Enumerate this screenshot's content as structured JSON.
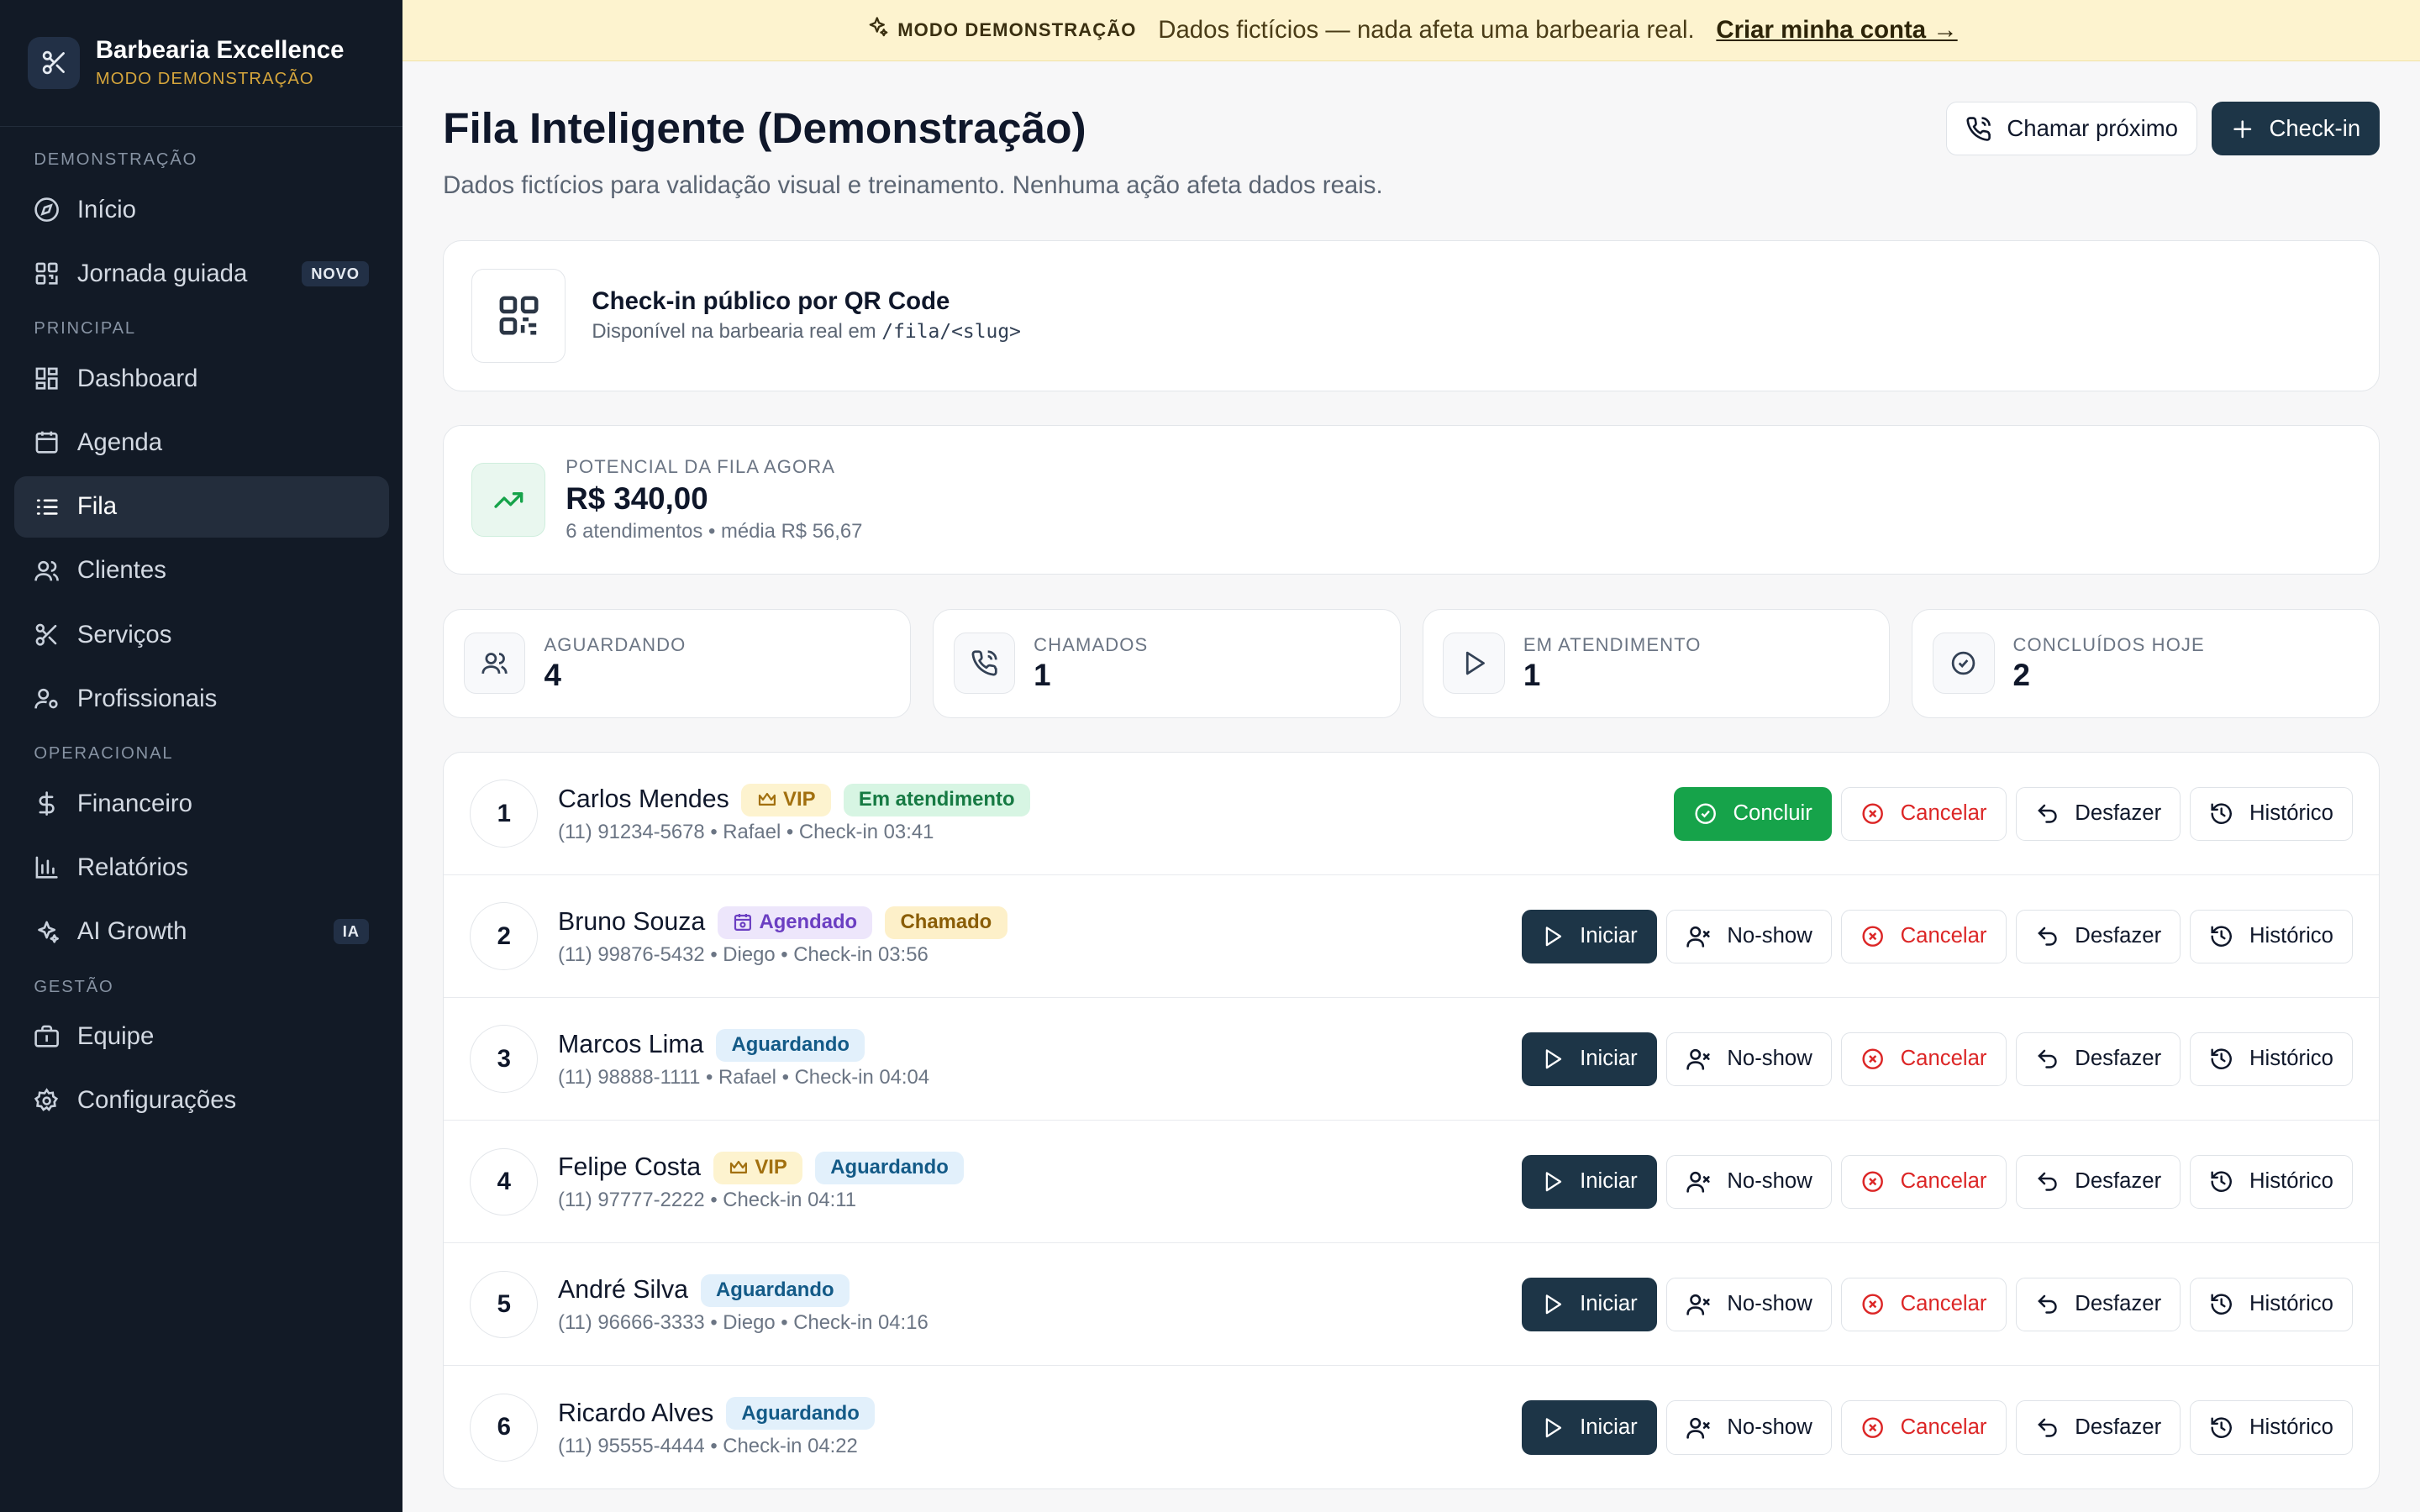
{
  "sidebar": {
    "brand_name": "Barbearia Excellence",
    "brand_sub": "MODO DEMONSTRAÇÃO",
    "sections": {
      "demo": "DEMONSTRAÇÃO",
      "principal": "PRINCIPAL",
      "operacional": "OPERACIONAL",
      "gestao": "GESTÃO"
    },
    "items": {
      "inicio": "Início",
      "jornada": "Jornada guiada",
      "jornada_badge": "NOVO",
      "dashboard": "Dashboard",
      "agenda": "Agenda",
      "fila": "Fila",
      "clientes": "Clientes",
      "servicos": "Serviços",
      "profissionais": "Profissionais",
      "financeiro": "Financeiro",
      "relatorios": "Relatórios",
      "aigrowth": "AI Growth",
      "aigrowth_badge": "IA",
      "equipe": "Equipe",
      "config": "Configurações"
    }
  },
  "banner": {
    "tag": "MODO DEMONSTRAÇÃO",
    "text": "Dados fictícios — nada afeta uma barbearia real.",
    "link": "Criar minha conta →"
  },
  "header": {
    "title": "Fila Inteligente (Demonstração)",
    "subtitle": "Dados fictícios para validação visual e treinamento. Nenhuma ação afeta dados reais.",
    "call_next": "Chamar próximo",
    "checkin": "Check-in"
  },
  "qr": {
    "title": "Check-in público por QR Code",
    "desc": "Disponível na barbearia real em",
    "path": "/fila/<slug>"
  },
  "potential": {
    "label": "POTENCIAL DA FILA AGORA",
    "value": "R$ 340,00",
    "sub": "6 atendimentos • média R$ 56,67"
  },
  "stats": {
    "waiting_label": "AGUARDANDO",
    "waiting": "4",
    "called_label": "CHAMADOS",
    "called": "1",
    "serving_label": "EM ATENDIMENTO",
    "serving": "1",
    "done_label": "CONCLUÍDOS HOJE",
    "done": "2"
  },
  "actions": {
    "concluir": "Concluir",
    "iniciar": "Iniciar",
    "noshow": "No-show",
    "cancelar": "Cancelar",
    "desfazer": "Desfazer",
    "historico": "Histórico"
  },
  "queue": [
    {
      "pos": "1",
      "name": "Carlos Mendes",
      "vip": "VIP",
      "status": "Em atendimento",
      "meta": "(11) 91234-5678 • Rafael • Check-in 03:41"
    },
    {
      "pos": "2",
      "name": "Bruno Souza",
      "tag": "Agendado",
      "status": "Chamado",
      "meta": "(11) 99876-5432 • Diego • Check-in 03:56"
    },
    {
      "pos": "3",
      "name": "Marcos Lima",
      "status": "Aguardando",
      "meta": "(11) 98888-1111 • Rafael • Check-in 04:04"
    },
    {
      "pos": "4",
      "name": "Felipe Costa",
      "vip": "VIP",
      "status": "Aguardando",
      "meta": "(11) 97777-2222 • Check-in 04:11"
    },
    {
      "pos": "5",
      "name": "André Silva",
      "status": "Aguardando",
      "meta": "(11) 96666-3333 • Diego • Check-in 04:16"
    },
    {
      "pos": "6",
      "name": "Ricardo Alves",
      "status": "Aguardando",
      "meta": "(11) 95555-4444 • Check-in 04:22"
    }
  ]
}
